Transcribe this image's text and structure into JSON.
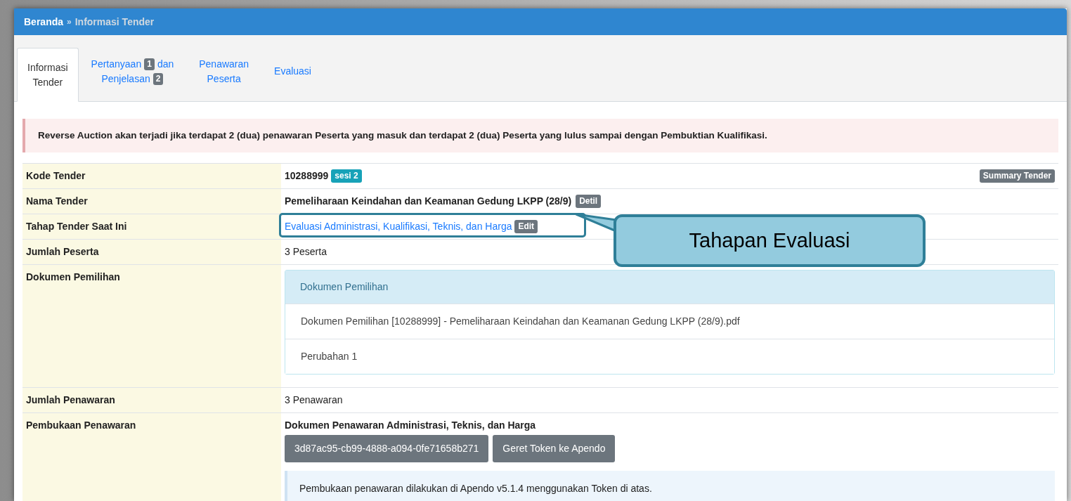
{
  "breadcrumb": [
    {
      "label": "Beranda",
      "kind": "link"
    },
    {
      "label": "»",
      "kind": "separator"
    },
    {
      "label": "Informasi Tender",
      "kind": "current"
    }
  ],
  "tabs": [
    {
      "selected": true,
      "lines": [
        [
          {
            "kind": "text",
            "text": "Informasi"
          }
        ],
        [
          {
            "kind": "text",
            "text": "Tender"
          }
        ]
      ]
    },
    {
      "selected": false,
      "lines": [
        [
          {
            "kind": "text",
            "text": "Pertanyaan"
          },
          {
            "kind": "badge",
            "text": "1"
          },
          {
            "kind": "text",
            "text": "dan"
          }
        ],
        [
          {
            "kind": "text",
            "text": "Penjelasan"
          },
          {
            "kind": "badge",
            "text": "2"
          }
        ]
      ]
    },
    {
      "selected": false,
      "lines": [
        [
          {
            "kind": "text",
            "text": "Penawaran"
          }
        ],
        [
          {
            "kind": "text",
            "text": "Peserta"
          }
        ]
      ]
    },
    {
      "selected": false,
      "lines": [
        [
          {
            "kind": "text",
            "text": "Evaluasi"
          }
        ]
      ]
    }
  ],
  "alert": "Reverse Auction akan terjadi jika terdapat 2 (dua) penawaran Peserta yang masuk dan terdapat 2 (dua) Peserta yang lulus sampai dengan Pembuktian Kualifikasi.",
  "rows": [
    {
      "label": "Kode Tender",
      "kind": "code",
      "value": "10288999",
      "badge": "sesi 2",
      "button": "Summary Tender"
    },
    {
      "label": "Nama Tender",
      "kind": "name",
      "value": "Pemeliharaan Keindahan dan Keamanan Gedung LKPP (28/9)",
      "button": "Detil"
    },
    {
      "label": "Tahap Tender Saat Ini",
      "kind": "link",
      "value": "Evaluasi Administrasi, Kualifikasi, Teknis, dan Harga",
      "button": "Edit"
    },
    {
      "label": "Jumlah Peserta",
      "kind": "text",
      "value": "3 Peserta"
    },
    {
      "label": "Dokumen Pemilihan",
      "kind": "panel",
      "heading": "Dokumen Pemilihan",
      "items": [
        "Dokumen Pemilihan [10288999] - Pemeliharaan Keindahan dan Keamanan Gedung LKPP (28/9).pdf",
        "Perubahan 1"
      ]
    },
    {
      "label": "Jumlah Penawaran",
      "kind": "text",
      "value": "3 Penawaran"
    },
    {
      "label": "Pembukaan Penawaran",
      "kind": "opening",
      "heading": "Dokumen Penawaran Administrasi, Teknis, dan Harga",
      "token": "3d87ac95-cb99-4888-a094-0fe71658b271",
      "button": "Geret Token ke Apendo",
      "note": "Pembukaan penawaran dilakukan di Apendo v5.1.4 menggunakan Token di atas."
    }
  ],
  "callout": {
    "text": "Tahapan Evaluasi"
  }
}
